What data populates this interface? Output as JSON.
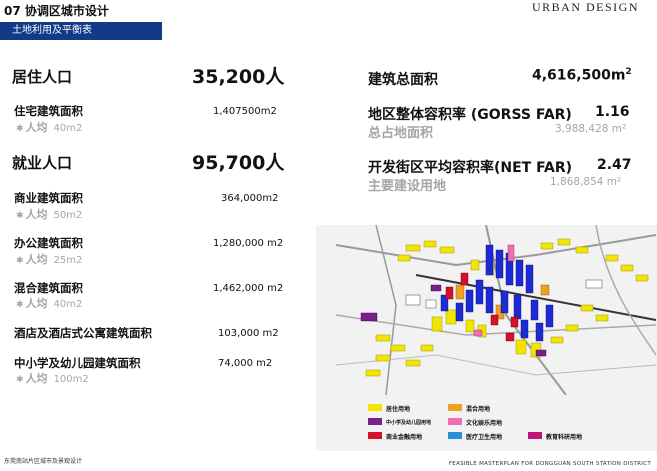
{
  "header": {
    "section_title": "07 协调区城市设计",
    "brand": "URBAN DESIGN",
    "subtitle": "土地利用及平衡表"
  },
  "left": {
    "residential_pop_label": "居住人口",
    "residential_pop_value": "35,200人",
    "housing_area_label": "住宅建筑面积",
    "housing_area_value": "1,407500m2",
    "housing_per_label": "人均",
    "housing_per_value": "40m2",
    "employment_pop_label": "就业人口",
    "employment_pop_value": "95,700人",
    "commercial_label": "商业建筑面积",
    "commercial_value": "364,000m2",
    "commercial_per_label": "人均",
    "commercial_per_value": "50m2",
    "office_label": "办公建筑面积",
    "office_value": "1,280,000 m2",
    "office_per_label": "人均",
    "office_per_value": "25m2",
    "mixed_label": "混合建筑面积",
    "mixed_value": "1,462,000 m2",
    "mixed_per_label": "人均",
    "mixed_per_value": "40m2",
    "hotel_label": "酒店及酒店式公寓建筑面积",
    "hotel_value": "103,000 m2",
    "school_label": "中小学及幼儿园建筑面积",
    "school_value": "74,000 m2",
    "school_per_label": "人均",
    "school_per_value": "100m2"
  },
  "right": {
    "total_area_label": "建筑总面积",
    "total_area_value": "4,616,500m",
    "gross_far_label": "地区整体容积率 (GORSS FAR)",
    "gross_far_value": "1.16",
    "land_area_label": "总占地面积",
    "land_area_value": "3,988,428 m²",
    "net_far_label": "开发街区平均容积率(NET FAR)",
    "net_far_value": "2.47",
    "main_land_label": "主要建设用地",
    "main_land_value": "1,868,854 m²"
  },
  "legend": {
    "items": [
      {
        "label": "居住用地",
        "color": "#f2e600"
      },
      {
        "label": "混合用地",
        "color": "#f0a020"
      },
      {
        "label": "中小学及幼儿园用地",
        "color": "#7a1f8c"
      },
      {
        "label": "文化娱乐用地",
        "color": "#f06fb0"
      },
      {
        "label": "商业金融用地",
        "color": "#d4102a"
      },
      {
        "label": "医疗卫生用地",
        "color": "#2a8fd8"
      },
      {
        "label": "教育科研用地",
        "color": "#c0147a"
      }
    ]
  },
  "colors": {
    "header_bar": "#123a86",
    "office_blue": "#1d2bd6"
  },
  "footer": {
    "left_line1": "东莞南站片区城市及景观设计",
    "left_line2": "",
    "right": "FEASIBLE MASTERPLAN FOR DONGGUAN SOUTH STATION DISTRICT"
  }
}
